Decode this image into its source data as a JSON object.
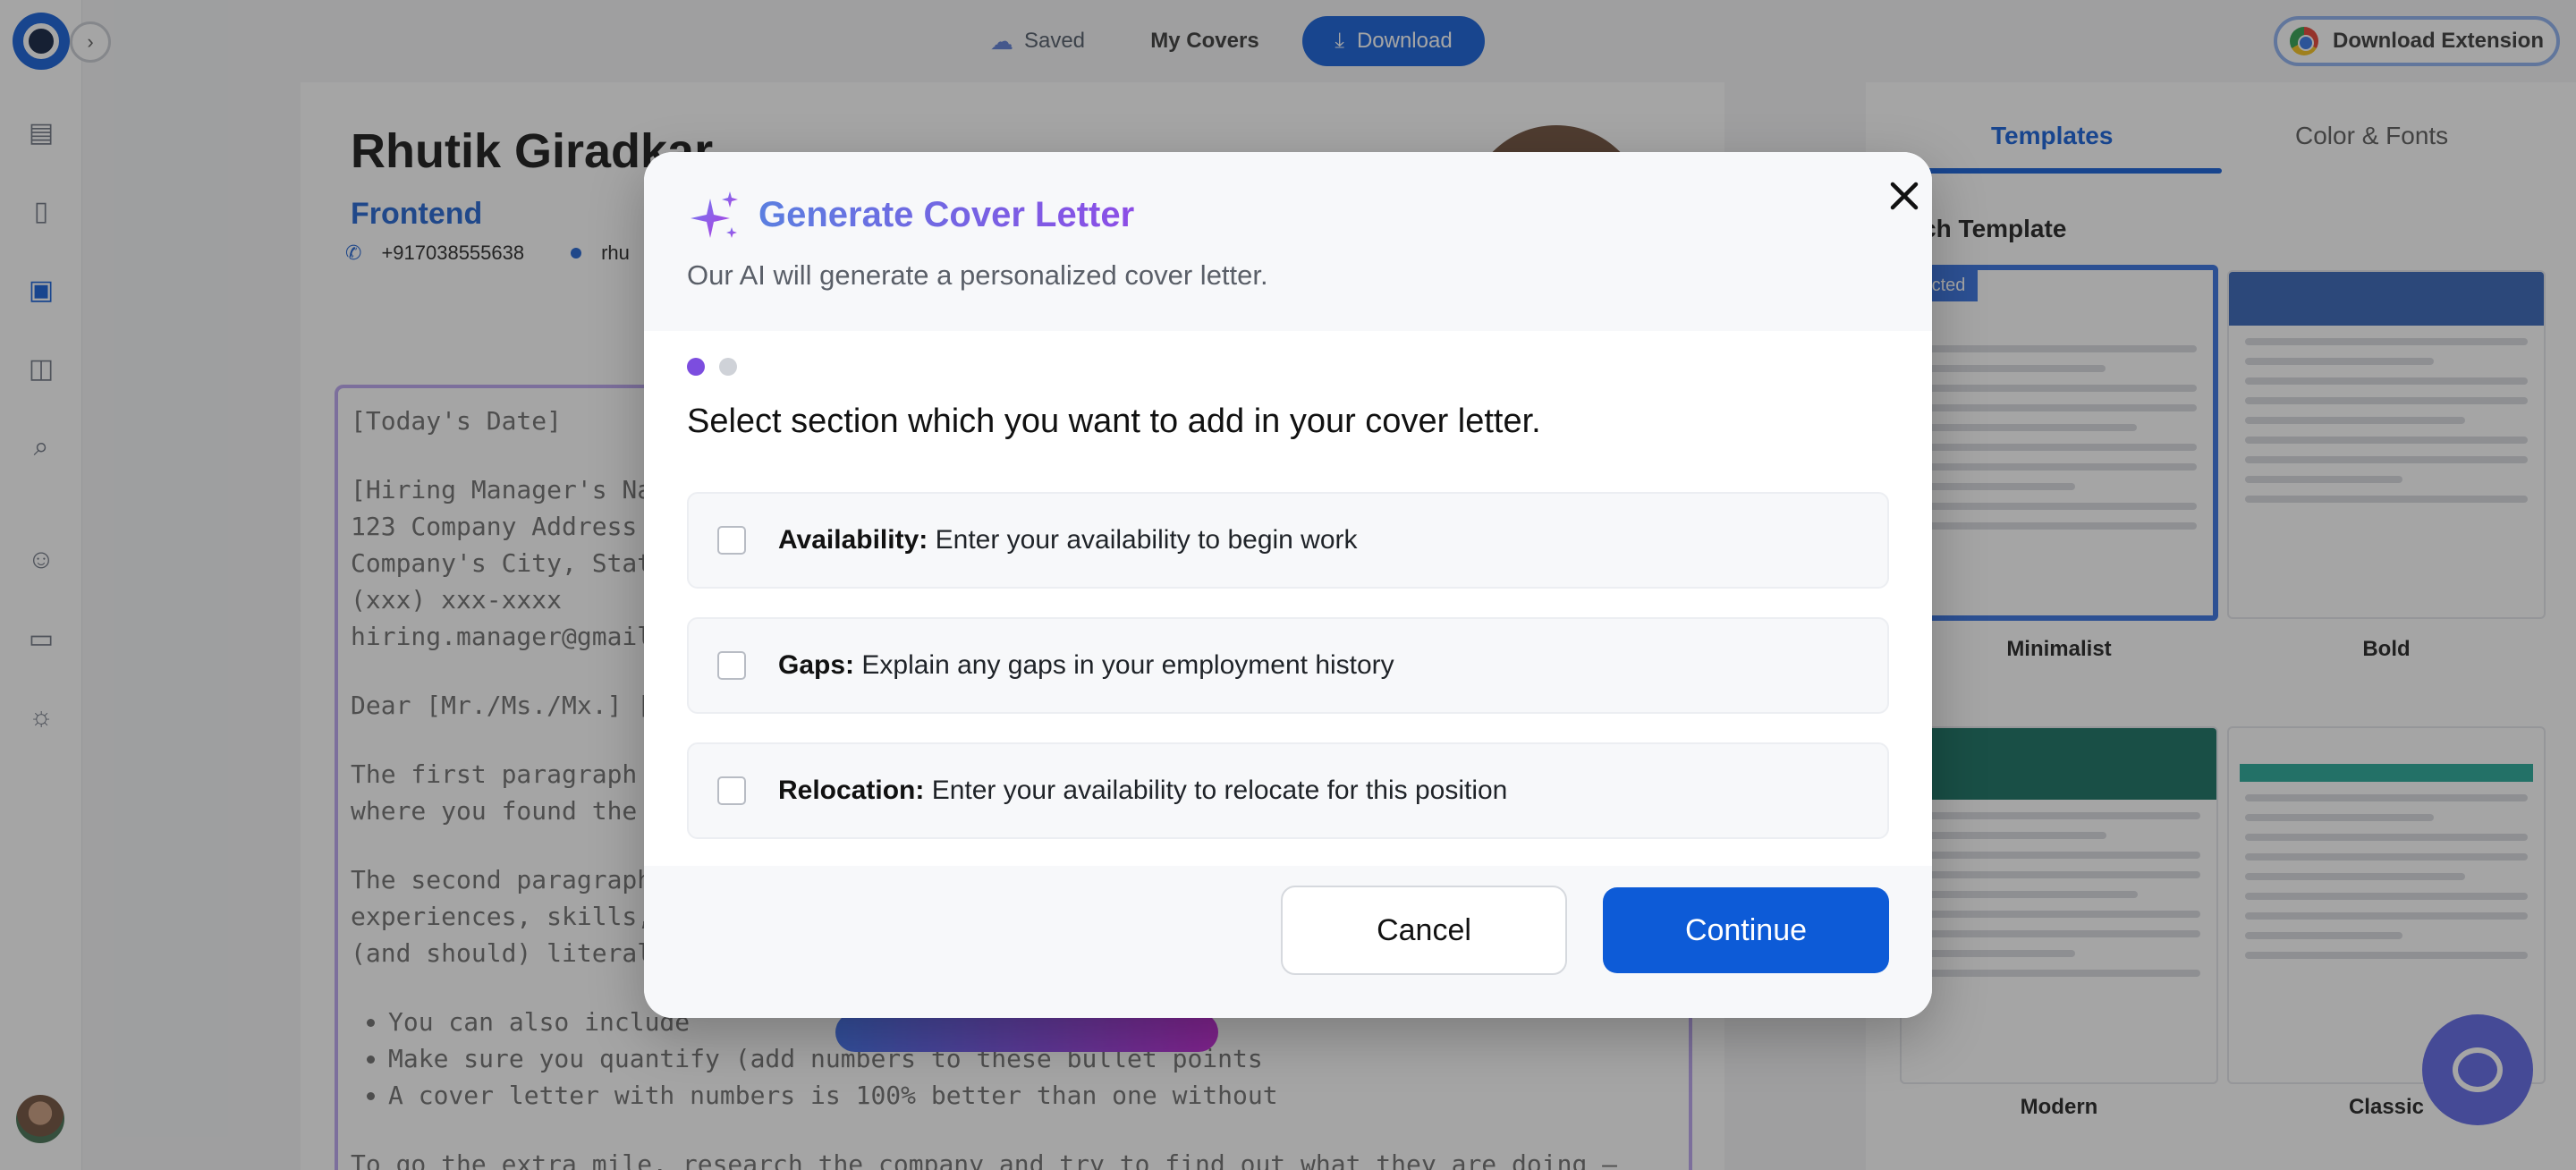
{
  "topbar": {
    "saved_label": "Saved",
    "my_covers_label": "My Covers",
    "download_label": "Download",
    "extension_label": "Download Extension"
  },
  "sidebar": {
    "icons": [
      "dashboard-icon",
      "document-icon",
      "cover-letter-icon",
      "interview-icon",
      "job-search-icon",
      "people-icon",
      "video-icon",
      "lightbulb-icon"
    ]
  },
  "document": {
    "name": "Rhutik Giradkar",
    "role": "Frontend",
    "phone": "+917038555638",
    "email_partial": "rhu",
    "date_placeholder": "[Today's Date]",
    "address_lines": [
      "[Hiring Manager's Nam",
      "123 Company Address",
      "Company's City, State,",
      "(xxx) xxx-xxxx",
      "hiring.manager@gmail"
    ],
    "salutation": "Dear [Mr./Ms./Mx.] [H",
    "paragraph_1": [
      "The first paragraph sh",
      "where you found the jo"
    ],
    "paragraph_2": [
      "The second paragraph",
      "experiences, skills, and",
      "(and should) literally in"
    ],
    "bullets": [
      "You can also include",
      "Make sure you quantify (add numbers to these bullet points",
      "A cover letter with numbers is 100% better than one without"
    ],
    "closing": "To go the extra mile, research the company and try to find out what they are doing — and why —"
  },
  "right_panel": {
    "tab_templates": "Templates",
    "tab_color_fonts": "Color & Fonts",
    "section_title": "itch Template",
    "selected_badge": "lected",
    "templates": [
      "Minimalist",
      "Bold",
      "Modern",
      "Classic"
    ]
  },
  "modal": {
    "title": "Generate Cover Letter",
    "subtitle": "Our AI will generate a personalized cover letter.",
    "question": "Select section which you want to add in your cover letter.",
    "step_count": 2,
    "current_step": 1,
    "options": [
      {
        "label": "Availability:",
        "description": "Enter your availability to begin work",
        "checked": false
      },
      {
        "label": "Gaps:",
        "description": "Explain any gaps in your employment history",
        "checked": false
      },
      {
        "label": "Relocation:",
        "description": "Enter your availability to relocate for this position",
        "checked": false
      }
    ],
    "cancel_label": "Cancel",
    "continue_label": "Continue",
    "accent_color": "#0d5bd7",
    "title_gradient": [
      "#5b7fe0",
      "#8c4de6"
    ]
  }
}
